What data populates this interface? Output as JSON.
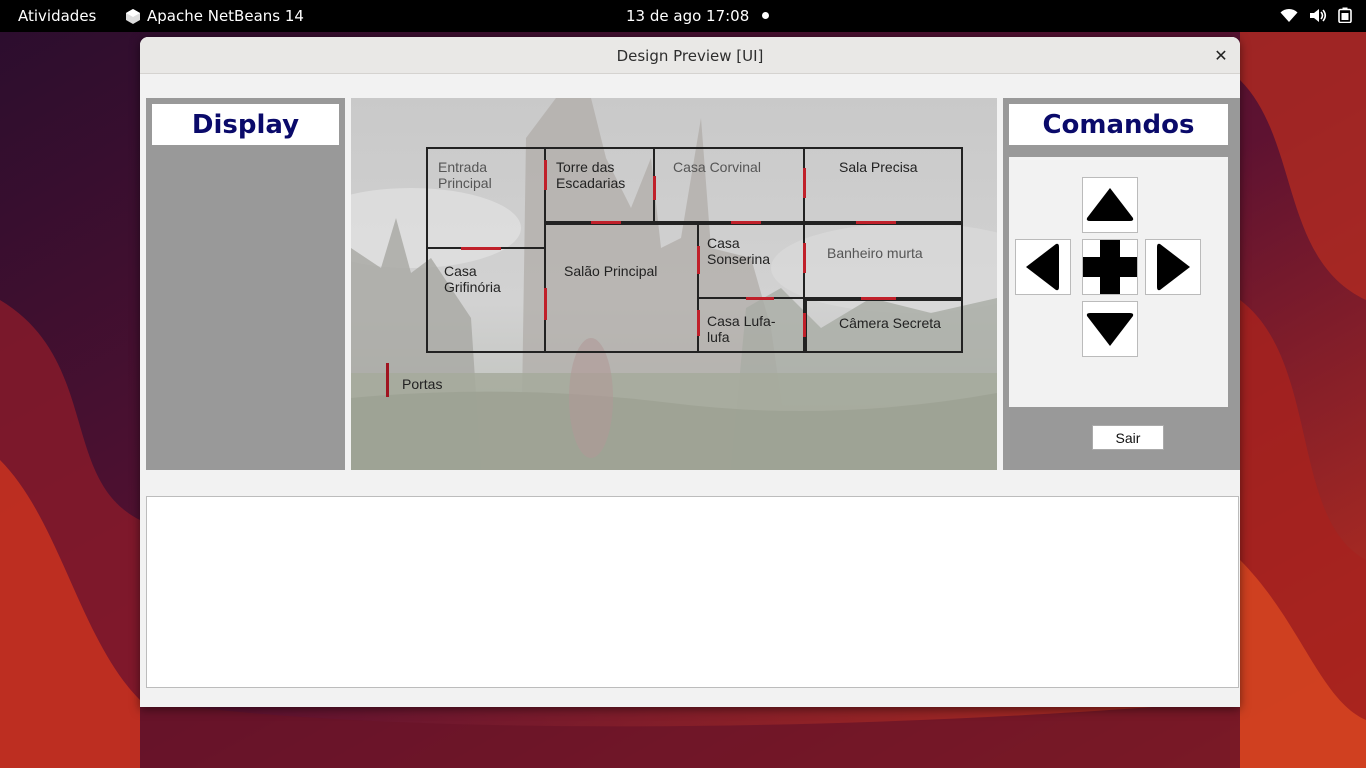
{
  "topbar": {
    "activities": "Atividades",
    "app_name": "Apache NetBeans 14",
    "clock": "13 de ago  17:08"
  },
  "window": {
    "title": "Design Preview [UI]",
    "close_glyph": "✕"
  },
  "display": {
    "title": "Display"
  },
  "map": {
    "rooms": [
      {
        "label": "Entrada Principal"
      },
      {
        "label": "Torre das Escadarias"
      },
      {
        "label": "Casa Corvinal"
      },
      {
        "label": "Sala Precisa"
      },
      {
        "label": "Casa Grifinória"
      },
      {
        "label": "Salão Principal"
      },
      {
        "label": "Casa Sonserina"
      },
      {
        "label": "Banheiro murta"
      },
      {
        "label": "Casa Lufa-lufa"
      },
      {
        "label": "Câmera Secreta"
      }
    ],
    "legend_label": "Portas",
    "door_color": "#c0202a"
  },
  "commands": {
    "title": "Comandos",
    "exit_label": "Sair",
    "icons": [
      "arrow-up-icon",
      "arrow-left-icon",
      "cross-icon",
      "arrow-right-icon",
      "arrow-down-icon"
    ]
  },
  "output": {
    "text": ""
  },
  "colors": {
    "header_text": "#0a0a6a",
    "panel_gray": "#999999"
  }
}
